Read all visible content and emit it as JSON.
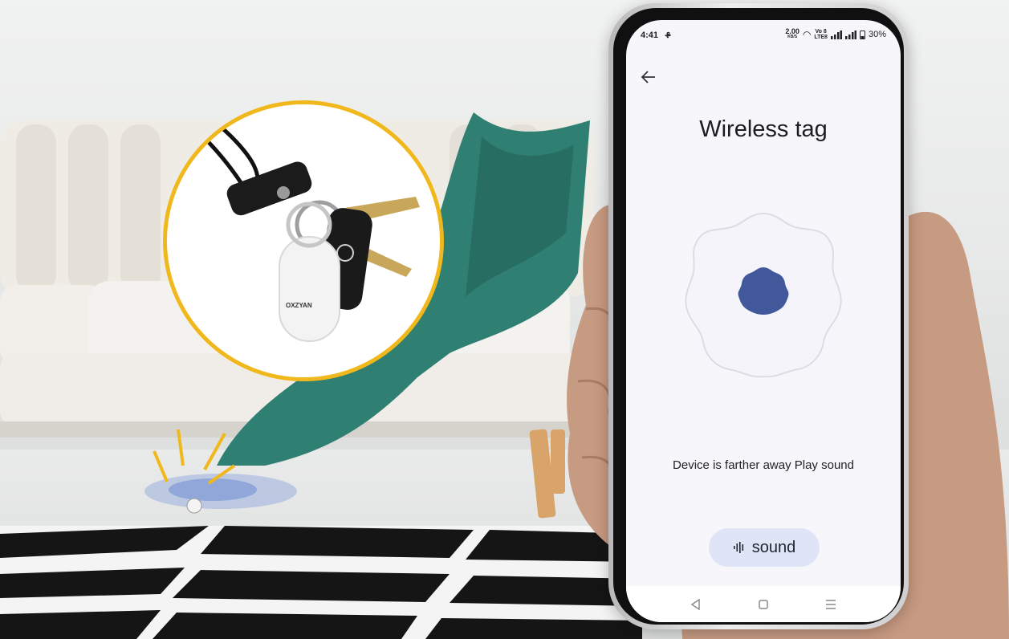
{
  "status_bar": {
    "time": "4:41",
    "speed_value": "2.00",
    "speed_unit": "KB/S",
    "volte_top": "Vo 8",
    "volte_bottom": "LTE8",
    "battery": "30%"
  },
  "page": {
    "title": "Wireless tag",
    "message": "Device is farther away Play sound",
    "sound_button_label": "sound"
  },
  "product": {
    "brand": "OXZYAN"
  },
  "colors": {
    "accent": "#41599a",
    "sound_button_bg": "#dfe4f7",
    "zoom_ring": "#f0b81c",
    "blanket": "#2f7f72"
  },
  "icons": {
    "back": "arrow-left-icon",
    "sound": "sound-wave-icon",
    "nav_back": "triangle-back-icon",
    "nav_home": "square-home-icon",
    "nav_menu": "menu-lines-icon"
  }
}
